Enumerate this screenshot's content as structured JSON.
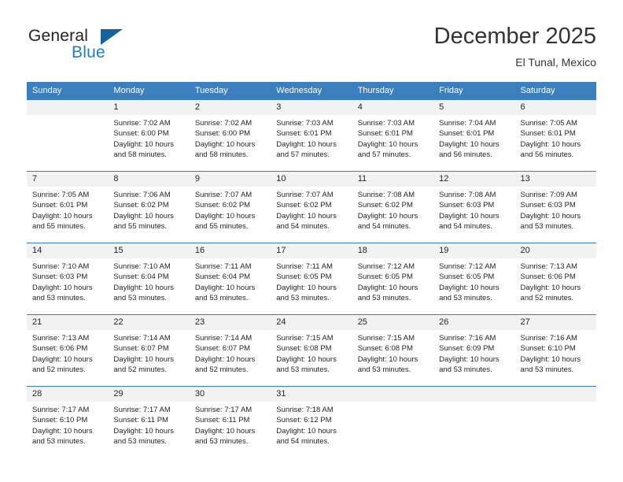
{
  "brand": {
    "line1": "General",
    "line2": "Blue",
    "accent_color": "#1f7fc4",
    "triangle_color": "#15639e"
  },
  "header": {
    "month_title": "December 2025",
    "location": "El Tunal, Mexico"
  },
  "calendar": {
    "header_bg": "#3b7fbe",
    "daynum_bg": "#f2f2f2",
    "weekdays": [
      "Sunday",
      "Monday",
      "Tuesday",
      "Wednesday",
      "Thursday",
      "Friday",
      "Saturday"
    ],
    "weeks": [
      [
        {
          "day": "",
          "sunrise": "",
          "sunset": "",
          "daylight1": "",
          "daylight2": ""
        },
        {
          "day": "1",
          "sunrise": "Sunrise: 7:02 AM",
          "sunset": "Sunset: 6:00 PM",
          "daylight1": "Daylight: 10 hours",
          "daylight2": "and 58 minutes."
        },
        {
          "day": "2",
          "sunrise": "Sunrise: 7:02 AM",
          "sunset": "Sunset: 6:00 PM",
          "daylight1": "Daylight: 10 hours",
          "daylight2": "and 58 minutes."
        },
        {
          "day": "3",
          "sunrise": "Sunrise: 7:03 AM",
          "sunset": "Sunset: 6:01 PM",
          "daylight1": "Daylight: 10 hours",
          "daylight2": "and 57 minutes."
        },
        {
          "day": "4",
          "sunrise": "Sunrise: 7:03 AM",
          "sunset": "Sunset: 6:01 PM",
          "daylight1": "Daylight: 10 hours",
          "daylight2": "and 57 minutes."
        },
        {
          "day": "5",
          "sunrise": "Sunrise: 7:04 AM",
          "sunset": "Sunset: 6:01 PM",
          "daylight1": "Daylight: 10 hours",
          "daylight2": "and 56 minutes."
        },
        {
          "day": "6",
          "sunrise": "Sunrise: 7:05 AM",
          "sunset": "Sunset: 6:01 PM",
          "daylight1": "Daylight: 10 hours",
          "daylight2": "and 56 minutes."
        }
      ],
      [
        {
          "day": "7",
          "sunrise": "Sunrise: 7:05 AM",
          "sunset": "Sunset: 6:01 PM",
          "daylight1": "Daylight: 10 hours",
          "daylight2": "and 55 minutes."
        },
        {
          "day": "8",
          "sunrise": "Sunrise: 7:06 AM",
          "sunset": "Sunset: 6:02 PM",
          "daylight1": "Daylight: 10 hours",
          "daylight2": "and 55 minutes."
        },
        {
          "day": "9",
          "sunrise": "Sunrise: 7:07 AM",
          "sunset": "Sunset: 6:02 PM",
          "daylight1": "Daylight: 10 hours",
          "daylight2": "and 55 minutes."
        },
        {
          "day": "10",
          "sunrise": "Sunrise: 7:07 AM",
          "sunset": "Sunset: 6:02 PM",
          "daylight1": "Daylight: 10 hours",
          "daylight2": "and 54 minutes."
        },
        {
          "day": "11",
          "sunrise": "Sunrise: 7:08 AM",
          "sunset": "Sunset: 6:02 PM",
          "daylight1": "Daylight: 10 hours",
          "daylight2": "and 54 minutes."
        },
        {
          "day": "12",
          "sunrise": "Sunrise: 7:08 AM",
          "sunset": "Sunset: 6:03 PM",
          "daylight1": "Daylight: 10 hours",
          "daylight2": "and 54 minutes."
        },
        {
          "day": "13",
          "sunrise": "Sunrise: 7:09 AM",
          "sunset": "Sunset: 6:03 PM",
          "daylight1": "Daylight: 10 hours",
          "daylight2": "and 53 minutes."
        }
      ],
      [
        {
          "day": "14",
          "sunrise": "Sunrise: 7:10 AM",
          "sunset": "Sunset: 6:03 PM",
          "daylight1": "Daylight: 10 hours",
          "daylight2": "and 53 minutes."
        },
        {
          "day": "15",
          "sunrise": "Sunrise: 7:10 AM",
          "sunset": "Sunset: 6:04 PM",
          "daylight1": "Daylight: 10 hours",
          "daylight2": "and 53 minutes."
        },
        {
          "day": "16",
          "sunrise": "Sunrise: 7:11 AM",
          "sunset": "Sunset: 6:04 PM",
          "daylight1": "Daylight: 10 hours",
          "daylight2": "and 53 minutes."
        },
        {
          "day": "17",
          "sunrise": "Sunrise: 7:11 AM",
          "sunset": "Sunset: 6:05 PM",
          "daylight1": "Daylight: 10 hours",
          "daylight2": "and 53 minutes."
        },
        {
          "day": "18",
          "sunrise": "Sunrise: 7:12 AM",
          "sunset": "Sunset: 6:05 PM",
          "daylight1": "Daylight: 10 hours",
          "daylight2": "and 53 minutes."
        },
        {
          "day": "19",
          "sunrise": "Sunrise: 7:12 AM",
          "sunset": "Sunset: 6:05 PM",
          "daylight1": "Daylight: 10 hours",
          "daylight2": "and 53 minutes."
        },
        {
          "day": "20",
          "sunrise": "Sunrise: 7:13 AM",
          "sunset": "Sunset: 6:06 PM",
          "daylight1": "Daylight: 10 hours",
          "daylight2": "and 52 minutes."
        }
      ],
      [
        {
          "day": "21",
          "sunrise": "Sunrise: 7:13 AM",
          "sunset": "Sunset: 6:06 PM",
          "daylight1": "Daylight: 10 hours",
          "daylight2": "and 52 minutes."
        },
        {
          "day": "22",
          "sunrise": "Sunrise: 7:14 AM",
          "sunset": "Sunset: 6:07 PM",
          "daylight1": "Daylight: 10 hours",
          "daylight2": "and 52 minutes."
        },
        {
          "day": "23",
          "sunrise": "Sunrise: 7:14 AM",
          "sunset": "Sunset: 6:07 PM",
          "daylight1": "Daylight: 10 hours",
          "daylight2": "and 52 minutes."
        },
        {
          "day": "24",
          "sunrise": "Sunrise: 7:15 AM",
          "sunset": "Sunset: 6:08 PM",
          "daylight1": "Daylight: 10 hours",
          "daylight2": "and 53 minutes."
        },
        {
          "day": "25",
          "sunrise": "Sunrise: 7:15 AM",
          "sunset": "Sunset: 6:08 PM",
          "daylight1": "Daylight: 10 hours",
          "daylight2": "and 53 minutes."
        },
        {
          "day": "26",
          "sunrise": "Sunrise: 7:16 AM",
          "sunset": "Sunset: 6:09 PM",
          "daylight1": "Daylight: 10 hours",
          "daylight2": "and 53 minutes."
        },
        {
          "day": "27",
          "sunrise": "Sunrise: 7:16 AM",
          "sunset": "Sunset: 6:10 PM",
          "daylight1": "Daylight: 10 hours",
          "daylight2": "and 53 minutes."
        }
      ],
      [
        {
          "day": "28",
          "sunrise": "Sunrise: 7:17 AM",
          "sunset": "Sunset: 6:10 PM",
          "daylight1": "Daylight: 10 hours",
          "daylight2": "and 53 minutes."
        },
        {
          "day": "29",
          "sunrise": "Sunrise: 7:17 AM",
          "sunset": "Sunset: 6:11 PM",
          "daylight1": "Daylight: 10 hours",
          "daylight2": "and 53 minutes."
        },
        {
          "day": "30",
          "sunrise": "Sunrise: 7:17 AM",
          "sunset": "Sunset: 6:11 PM",
          "daylight1": "Daylight: 10 hours",
          "daylight2": "and 53 minutes."
        },
        {
          "day": "31",
          "sunrise": "Sunrise: 7:18 AM",
          "sunset": "Sunset: 6:12 PM",
          "daylight1": "Daylight: 10 hours",
          "daylight2": "and 54 minutes."
        },
        {
          "day": "",
          "sunrise": "",
          "sunset": "",
          "daylight1": "",
          "daylight2": ""
        },
        {
          "day": "",
          "sunrise": "",
          "sunset": "",
          "daylight1": "",
          "daylight2": ""
        },
        {
          "day": "",
          "sunrise": "",
          "sunset": "",
          "daylight1": "",
          "daylight2": ""
        }
      ]
    ]
  }
}
